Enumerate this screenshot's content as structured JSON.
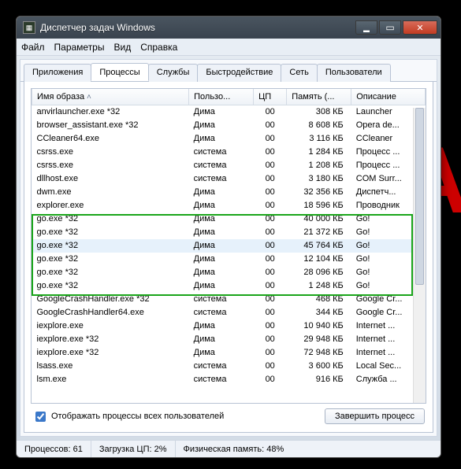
{
  "window": {
    "title": "Диспетчер задач Windows"
  },
  "menu": {
    "file": "Файл",
    "options": "Параметры",
    "view": "Вид",
    "help": "Справка"
  },
  "tabs": {
    "apps": "Приложения",
    "processes": "Процессы",
    "services": "Службы",
    "performance": "Быстродействие",
    "network": "Сеть",
    "users": "Пользователи"
  },
  "columns": {
    "image": "Имя образа",
    "user": "Пользо...",
    "cpu": "ЦП",
    "memory": "Память (...",
    "desc": "Описание"
  },
  "rows": [
    {
      "name": "anvirlauncher.exe *32",
      "user": "Дима",
      "cpu": "00",
      "mem": "308 КБ",
      "desc": "Launcher"
    },
    {
      "name": "browser_assistant.exe *32",
      "user": "Дима",
      "cpu": "00",
      "mem": "8 608 КБ",
      "desc": "Opera de..."
    },
    {
      "name": "CCleaner64.exe",
      "user": "Дима",
      "cpu": "00",
      "mem": "3 116 КБ",
      "desc": "CCleaner"
    },
    {
      "name": "csrss.exe",
      "user": "система",
      "cpu": "00",
      "mem": "1 284 КБ",
      "desc": "Процесс ..."
    },
    {
      "name": "csrss.exe",
      "user": "система",
      "cpu": "00",
      "mem": "1 208 КБ",
      "desc": "Процесс ..."
    },
    {
      "name": "dllhost.exe",
      "user": "система",
      "cpu": "00",
      "mem": "3 180 КБ",
      "desc": "COM Surr..."
    },
    {
      "name": "dwm.exe",
      "user": "Дима",
      "cpu": "00",
      "mem": "32 356 КБ",
      "desc": "Диспетч..."
    },
    {
      "name": "explorer.exe",
      "user": "Дима",
      "cpu": "00",
      "mem": "18 596 КБ",
      "desc": "Проводник"
    },
    {
      "name": "go.exe *32",
      "user": "Дима",
      "cpu": "00",
      "mem": "40 000 КБ",
      "desc": "Go!"
    },
    {
      "name": "go.exe *32",
      "user": "Дима",
      "cpu": "00",
      "mem": "21 372 КБ",
      "desc": "Go!"
    },
    {
      "name": "go.exe *32",
      "user": "Дима",
      "cpu": "00",
      "mem": "45 764 КБ",
      "desc": "Go!",
      "selected": true
    },
    {
      "name": "go.exe *32",
      "user": "Дима",
      "cpu": "00",
      "mem": "12 104 КБ",
      "desc": "Go!"
    },
    {
      "name": "go.exe *32",
      "user": "Дима",
      "cpu": "00",
      "mem": "28 096 КБ",
      "desc": "Go!"
    },
    {
      "name": "go.exe *32",
      "user": "Дима",
      "cpu": "00",
      "mem": "1 248 КБ",
      "desc": "Go!"
    },
    {
      "name": "GoogleCrashHandler.exe *32",
      "user": "система",
      "cpu": "00",
      "mem": "468 КБ",
      "desc": "Google Cr..."
    },
    {
      "name": "GoogleCrashHandler64.exe",
      "user": "система",
      "cpu": "00",
      "mem": "344 КБ",
      "desc": "Google Cr..."
    },
    {
      "name": "iexplore.exe",
      "user": "Дима",
      "cpu": "00",
      "mem": "10 940 КБ",
      "desc": "Internet ..."
    },
    {
      "name": "iexplore.exe *32",
      "user": "Дима",
      "cpu": "00",
      "mem": "29 948 КБ",
      "desc": "Internet ..."
    },
    {
      "name": "iexplore.exe *32",
      "user": "Дима",
      "cpu": "00",
      "mem": "72 948 КБ",
      "desc": "Internet ..."
    },
    {
      "name": "lsass.exe",
      "user": "система",
      "cpu": "00",
      "mem": "3 600 КБ",
      "desc": "Local Sec..."
    },
    {
      "name": "lsm.exe",
      "user": "система",
      "cpu": "00",
      "mem": "916 КБ",
      "desc": "Служба ..."
    }
  ],
  "highlight": {
    "startRow": 8,
    "endRow": 13
  },
  "controls": {
    "show_all_users": "Отображать процессы всех пользователей",
    "end_process": "Завершить процесс"
  },
  "status": {
    "procs_label": "Процессов:",
    "procs_val": "61",
    "cpu_label": "Загрузка ЦП:",
    "cpu_val": "2%",
    "mem_label": "Физическая память:",
    "mem_val": "48%"
  }
}
